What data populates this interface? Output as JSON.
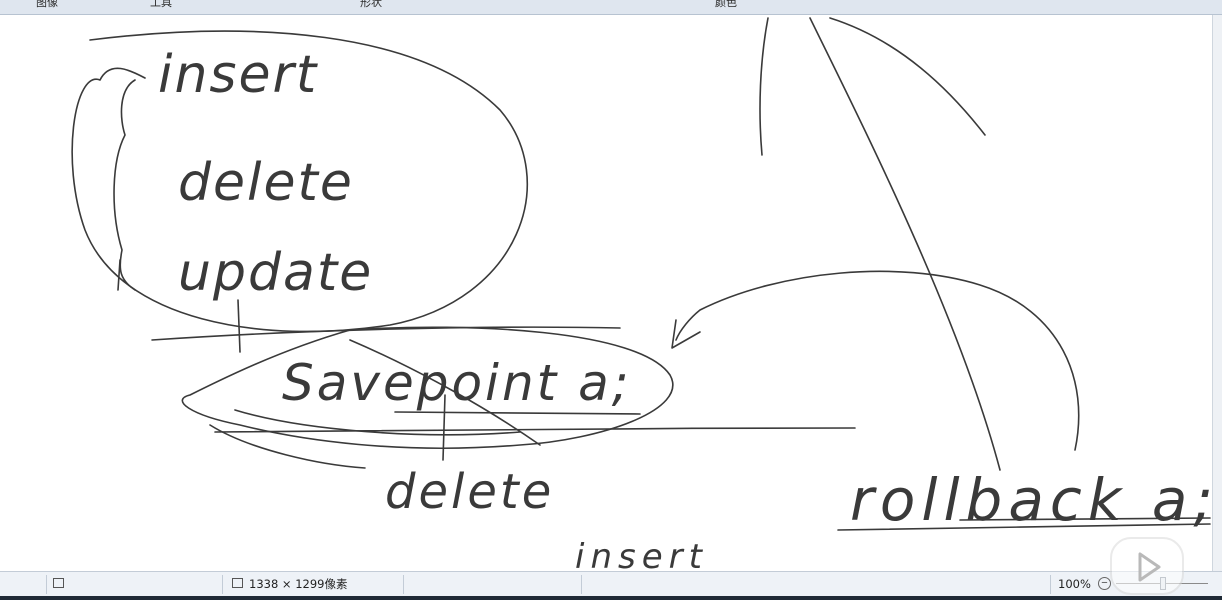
{
  "ribbon": {
    "labels": [
      "图像",
      "工具",
      "形状",
      "颜色"
    ]
  },
  "canvas": {
    "handwriting": {
      "insert": "insert",
      "delete": "delete",
      "update": "update",
      "savepoint": "Savepoint a;",
      "delete2": "delete",
      "insert2": "insert",
      "rollback": "rollback a;"
    }
  },
  "statusbar": {
    "image_size": "1338 × 1299像素",
    "zoom": "100%"
  },
  "colors": {
    "ink": "#3a3a3a",
    "ribbon_bg": "#dfe6ef",
    "status_bg": "#eef2f7"
  }
}
